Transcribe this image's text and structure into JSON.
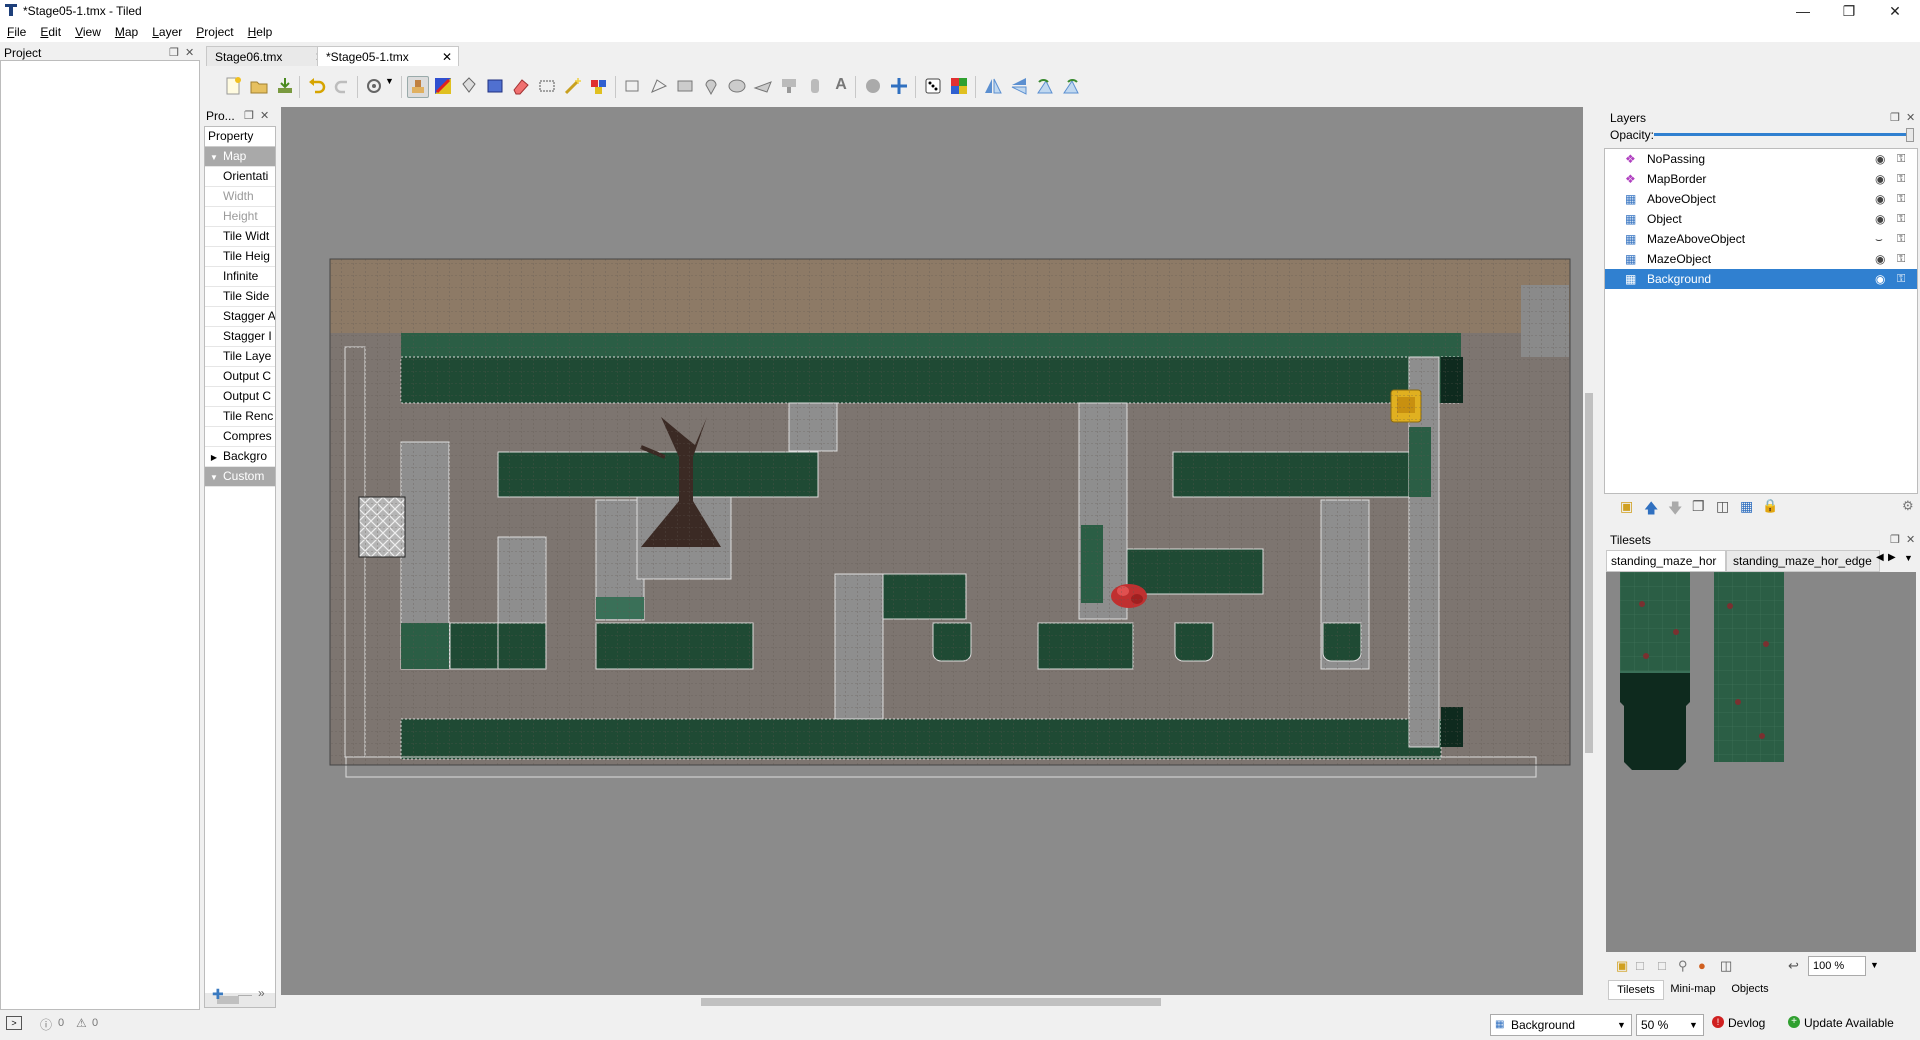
{
  "window": {
    "title": "*Stage05-1.tmx - Tiled"
  },
  "menu": [
    "File",
    "Edit",
    "View",
    "Map",
    "Layer",
    "Project",
    "Help"
  ],
  "project_panel": {
    "title": "Project"
  },
  "tabs": [
    {
      "label": "Stage06.tmx",
      "active": false
    },
    {
      "label": "*Stage05-1.tmx",
      "active": true
    }
  ],
  "properties": {
    "title": "Pro...",
    "header": "Property",
    "rows": [
      {
        "label": "Map",
        "group": true,
        "expanded": true
      },
      {
        "label": "Orientati",
        "dim": false
      },
      {
        "label": "Width",
        "dim": true
      },
      {
        "label": "Height",
        "dim": true
      },
      {
        "label": "Tile Widt",
        "dim": false
      },
      {
        "label": "Tile Heig",
        "dim": false
      },
      {
        "label": "Infinite",
        "dim": false
      },
      {
        "label": "Tile Side",
        "dim": false
      },
      {
        "label": "Stagger A",
        "dim": false
      },
      {
        "label": "Stagger I",
        "dim": false
      },
      {
        "label": "Tile Laye",
        "dim": false
      },
      {
        "label": "Output C",
        "dim": false
      },
      {
        "label": "Output C",
        "dim": false
      },
      {
        "label": "Tile Renc",
        "dim": false
      },
      {
        "label": "Compres",
        "dim": false
      },
      {
        "label": "Backgro",
        "dim": false,
        "collapsed": true
      },
      {
        "label": "Custom",
        "group": true,
        "expanded": true
      }
    ]
  },
  "layers": {
    "title": "Layers",
    "opacity_label": "Opacity:",
    "opacity": 1.0,
    "items": [
      {
        "name": "NoPassing",
        "kind": "object",
        "visible": true,
        "selected": false
      },
      {
        "name": "MapBorder",
        "kind": "object",
        "visible": true,
        "selected": false
      },
      {
        "name": "AboveObject",
        "kind": "tile",
        "visible": true,
        "selected": false
      },
      {
        "name": "Object",
        "kind": "tile",
        "visible": true,
        "selected": false
      },
      {
        "name": "MazeAboveObject",
        "kind": "tile",
        "visible": false,
        "selected": false
      },
      {
        "name": "MazeObject",
        "kind": "tile",
        "visible": true,
        "selected": false
      },
      {
        "name": "Background",
        "kind": "tile",
        "visible": true,
        "selected": true
      }
    ]
  },
  "tilesets": {
    "title": "Tilesets",
    "tabs": [
      "standing_maze_hor",
      "standing_maze_hor_edge"
    ],
    "zoom": "100 %",
    "bottom_tabs": [
      "Tilesets",
      "Mini-map",
      "Objects"
    ]
  },
  "status": {
    "errors": "0",
    "warnings": "0",
    "layer_select": "Background",
    "zoom": "50 %",
    "devlog": "Devlog",
    "update": "Update Available"
  },
  "colors": {
    "accent": "#3080d0",
    "canvas_bg": "#8b8b8b",
    "floor": "#7d7570",
    "top_band": "#8d7a66",
    "hedge": "#1f4a34",
    "hedge_light": "#2b5e45"
  }
}
